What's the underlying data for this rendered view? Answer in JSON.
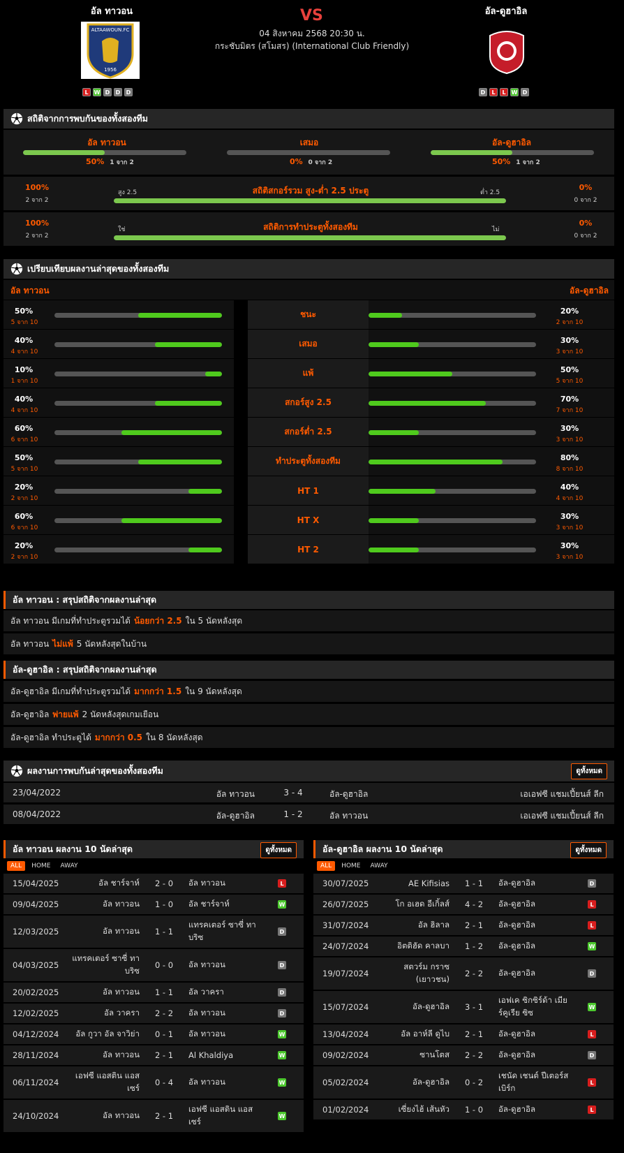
{
  "header": {
    "home_name": "อัล ทาวอน",
    "away_name": "อัล-ดูฮาอิล",
    "vs": "VS",
    "date": "04 สิงหาคม 2568 20:30 น.",
    "competition": "กระชับมิตร (สโมสร) (International Club Friendly)",
    "home_logo_text": "ALTAAWOUN.FC",
    "home_logo_year": "1956",
    "home_form": [
      "L",
      "W",
      "D",
      "D",
      "D"
    ],
    "away_form": [
      "D",
      "L",
      "L",
      "W",
      "D"
    ]
  },
  "h2h_stats": {
    "title": "สถิติจากการพบกันของทั้งสองทีม",
    "home": {
      "label": "อัล ทาวอน",
      "pct": "50%",
      "sub": "1 จาก 2",
      "value": 0.5
    },
    "draw": {
      "label": "เสมอ",
      "pct": "0%",
      "sub": "0 จาก 2",
      "value": 0
    },
    "away": {
      "label": "อัล-ดูฮาอิล",
      "pct": "50%",
      "sub": "1 จาก 2",
      "value": 0.5
    },
    "ou": {
      "title": "สถิติสกอร์รวม สูง-ต่ำ 2.5 ประตู",
      "left_pct": "100%",
      "left_sub": "2 จาก 2",
      "left_label": "สูง 2.5",
      "right_label": "ต่ำ 2.5",
      "right_pct": "0%",
      "right_sub": "0 จาก 2",
      "value": 1
    },
    "btts": {
      "title": "สถิติการทำประตูทั้งสองทีม",
      "left_pct": "100%",
      "left_sub": "2 จาก 2",
      "left_label": "ใช่",
      "right_label": "ไม่",
      "right_pct": "0%",
      "right_sub": "0 จาก 2",
      "value": 1
    }
  },
  "compare": {
    "title": "เปรียบเทียบผลงานล่าสุดของทั้งสองทีม",
    "home_name": "อัล ทาวอน",
    "away_name": "อัล-ดูฮาอิล",
    "rows": [
      {
        "label": "ชนะ",
        "hp": "50%",
        "hs": "5 จาก 10",
        "hv": 0.5,
        "ap": "20%",
        "as": "2 จาก 10",
        "av": 0.2
      },
      {
        "label": "เสมอ",
        "hp": "40%",
        "hs": "4 จาก 10",
        "hv": 0.4,
        "ap": "30%",
        "as": "3 จาก 10",
        "av": 0.3
      },
      {
        "label": "แพ้",
        "hp": "10%",
        "hs": "1 จาก 10",
        "hv": 0.1,
        "ap": "50%",
        "as": "5 จาก 10",
        "av": 0.5
      },
      {
        "label": "สกอร์สูง 2.5",
        "hp": "40%",
        "hs": "4 จาก 10",
        "hv": 0.4,
        "ap": "70%",
        "as": "7 จาก 10",
        "av": 0.7
      },
      {
        "label": "สกอร์ต่ำ 2.5",
        "hp": "60%",
        "hs": "6 จาก 10",
        "hv": 0.6,
        "ap": "30%",
        "as": "3 จาก 10",
        "av": 0.3
      },
      {
        "label": "ทำประตูทั้งสองทีม",
        "hp": "50%",
        "hs": "5 จาก 10",
        "hv": 0.5,
        "ap": "80%",
        "as": "8 จาก 10",
        "av": 0.8
      },
      {
        "label": "HT 1",
        "hp": "20%",
        "hs": "2 จาก 10",
        "hv": 0.2,
        "ap": "40%",
        "as": "4 จาก 10",
        "av": 0.4
      },
      {
        "label": "HT X",
        "hp": "60%",
        "hs": "6 จาก 10",
        "hv": 0.6,
        "ap": "30%",
        "as": "3 จาก 10",
        "av": 0.3
      },
      {
        "label": "HT 2",
        "hp": "20%",
        "hs": "2 จาก 10",
        "hv": 0.2,
        "ap": "30%",
        "as": "3 จาก 10",
        "av": 0.3
      }
    ]
  },
  "summary_home": {
    "title": "อัล ทาวอน : สรุปสถิติจากผลงานล่าสุด",
    "lines": [
      {
        "a": "อัล ทาวอน  มีเกมที่ทำประตูรวมได้",
        "o": "น้อยกว่า  2.5",
        "b": "ใน 5 นัดหลังสุด"
      },
      {
        "a": "อัล ทาวอน",
        "o": "ไม่แพ้",
        "b": "5  นัดหลังสุดในบ้าน"
      }
    ]
  },
  "summary_away": {
    "title": "อัล-ดูฮาอิล : สรุปสถิติจากผลงานล่าสุด",
    "lines": [
      {
        "a": "อัล-ดูฮาอิล  มีเกมที่ทำประตูรวมได้",
        "o": "มากกว่า  1.5",
        "b": "ใน 9 นัดหลังสุด"
      },
      {
        "a": "อัล-ดูฮาอิล",
        "o": "พ่ายแพ้",
        "b": "2  นัดหลังสุดเกมเยือน"
      },
      {
        "a": "อัล-ดูฮาอิล  ทำประตูได้",
        "o": "มากกว่า  0.5",
        "b": "ใน 8 นัดหลังสุด"
      }
    ]
  },
  "h2h_matches": {
    "title": "ผลงานการพบกันล่าสุดของทั้งสองทีม",
    "view_all": "ดูทั้งหมด",
    "rows": [
      {
        "date": "23/04/2022",
        "home": "อัล ทาวอน",
        "score": "3 - 4",
        "away": "อัล-ดูฮาอิล",
        "comp": "เอเอฟซี แชมเปี้ยนส์ ลีก"
      },
      {
        "date": "08/04/2022",
        "home": "อัล-ดูฮาอิล",
        "score": "1 - 2",
        "away": "อัล ทาวอน",
        "comp": "เอเอฟซี แชมเปี้ยนส์ ลีก"
      }
    ]
  },
  "last10_home": {
    "title": "อัล ทาวอน ผลงาน 10 นัดล่าสุด",
    "view_all": "ดูทั้งหมด",
    "tabs": [
      "ALL",
      "HOME",
      "AWAY"
    ],
    "rows": [
      {
        "date": "15/04/2025",
        "home": "อัล ชาร์จาห์",
        "score": "2 - 0",
        "away": "อัล ทาวอน",
        "res": "L"
      },
      {
        "date": "09/04/2025",
        "home": "อัล ทาวอน",
        "score": "1 - 0",
        "away": "อัล ชาร์จาห์",
        "res": "W"
      },
      {
        "date": "12/03/2025",
        "home": "อัล ทาวอน",
        "score": "1 - 1",
        "away": "แทรคเตอร์ ซาซี่ ทาบริซ",
        "res": "D"
      },
      {
        "date": "04/03/2025",
        "home": "แทรคเตอร์ ซาซี่ ทาบริซ",
        "score": "0 - 0",
        "away": "อัล ทาวอน",
        "res": "D"
      },
      {
        "date": "20/02/2025",
        "home": "อัล ทาวอน",
        "score": "1 - 1",
        "away": "อัล วาครา",
        "res": "D"
      },
      {
        "date": "12/02/2025",
        "home": "อัล วาครา",
        "score": "2 - 2",
        "away": "อัล ทาวอน",
        "res": "D"
      },
      {
        "date": "04/12/2024",
        "home": "อัล กูวา อัล จาวิย่า",
        "score": "0 - 1",
        "away": "อัล ทาวอน",
        "res": "W"
      },
      {
        "date": "28/11/2024",
        "home": "อัล ทาวอน",
        "score": "2 - 1",
        "away": "Al Khaldiya",
        "res": "W"
      },
      {
        "date": "06/11/2024",
        "home": "เอฟซี แอสติน แอสเซร์",
        "score": "0 - 4",
        "away": "อัล ทาวอน",
        "res": "W"
      },
      {
        "date": "24/10/2024",
        "home": "อัล ทาวอน",
        "score": "2 - 1",
        "away": "เอฟซี แอสติน แอสเซร์",
        "res": "W"
      }
    ]
  },
  "last10_away": {
    "title": "อัล-ดูฮาอิล ผลงาน 10 นัดล่าสุด",
    "view_all": "ดูทั้งหมด",
    "tabs": [
      "ALL",
      "HOME",
      "AWAY"
    ],
    "rows": [
      {
        "date": "30/07/2025",
        "home": "AE Kifisias",
        "score": "1 - 1",
        "away": "อัล-ดูฮาอิล",
        "res": "D"
      },
      {
        "date": "26/07/2025",
        "home": "โก อเฮด อีเกิ้ลส์",
        "score": "4 - 2",
        "away": "อัล-ดูฮาอิล",
        "res": "L"
      },
      {
        "date": "31/07/2024",
        "home": "อัล ฮิลาล",
        "score": "2 - 1",
        "away": "อัล-ดูฮาอิล",
        "res": "L"
      },
      {
        "date": "24/07/2024",
        "home": "อิตติฮัด คาลบา",
        "score": "1 - 2",
        "away": "อัล-ดูฮาอิล",
        "res": "W"
      },
      {
        "date": "19/07/2024",
        "home": "สตวร์ม กราซ (เยาวชน)",
        "score": "2 - 2",
        "away": "อัล-ดูฮาอิล",
        "res": "D"
      },
      {
        "date": "15/07/2024",
        "home": "อัล-ดูฮาอิล",
        "score": "3 - 1",
        "away": "เอฟเค ซิกซิร์ด้า เมียร์คูเรีย ซิซ",
        "res": "W"
      },
      {
        "date": "13/04/2024",
        "home": "อัล อาห์ลี ดูไบ",
        "score": "2 - 1",
        "away": "อัล-ดูฮาอิล",
        "res": "L"
      },
      {
        "date": "09/02/2024",
        "home": "ซานโตส",
        "score": "2 - 2",
        "away": "อัล-ดูฮาอิล",
        "res": "D"
      },
      {
        "date": "05/02/2024",
        "home": "อัล-ดูฮาอิล",
        "score": "0 - 2",
        "away": "เชนัด เชนต์ ปีเตอร์สเบิร์ก",
        "res": "L"
      },
      {
        "date": "01/02/2024",
        "home": "เซี่ยงไฮ้ เส้นหัว",
        "score": "1 - 0",
        "away": "อัล-ดูฮาอิล",
        "res": "L"
      }
    ]
  }
}
